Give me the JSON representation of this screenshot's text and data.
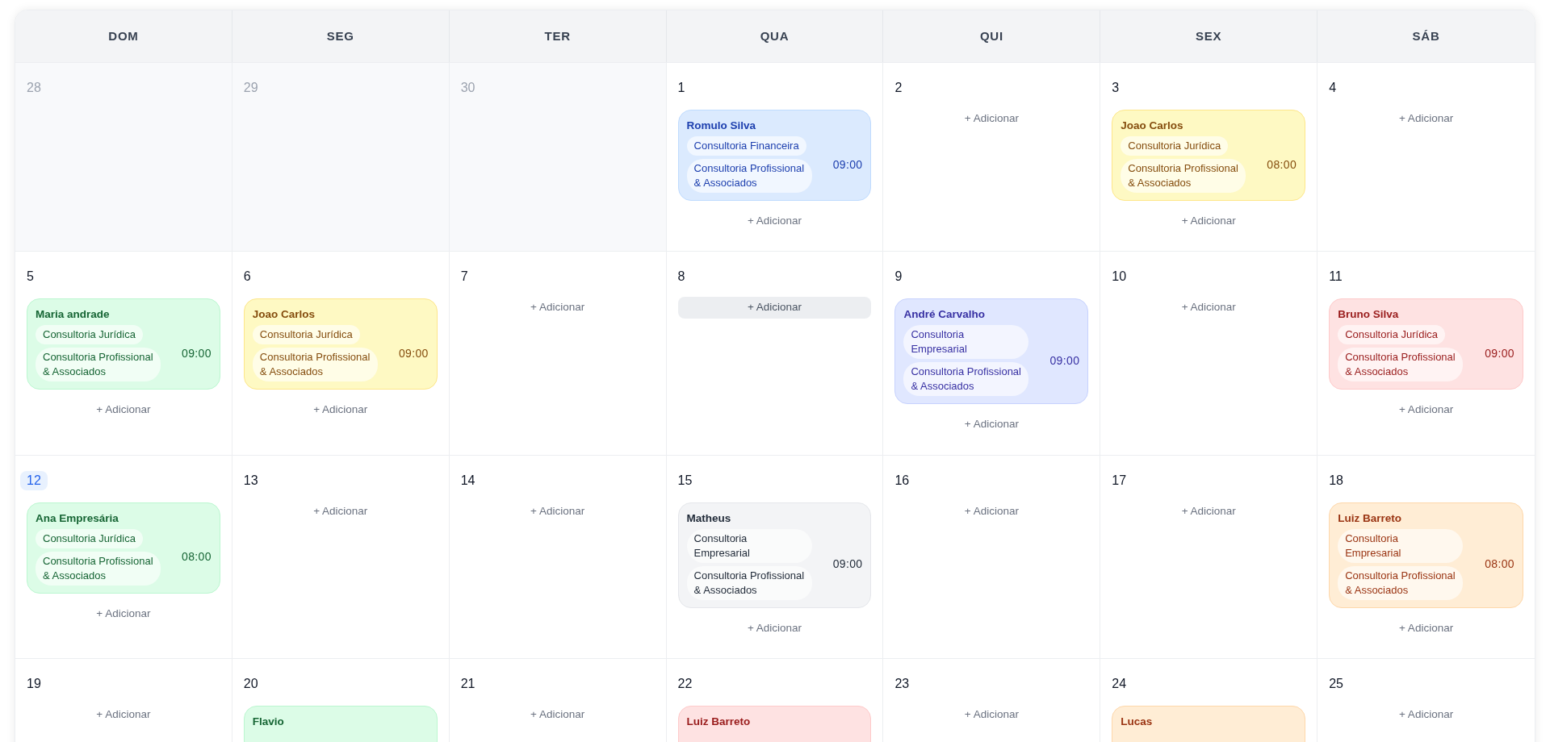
{
  "header": [
    "DOM",
    "SEG",
    "TER",
    "QUA",
    "QUI",
    "SEX",
    "SÁB"
  ],
  "weeks": [
    [
      {
        "day": "28",
        "outside_month": true,
        "today": false
      },
      {
        "day": "29",
        "outside_month": true,
        "today": false
      },
      {
        "day": "30",
        "outside_month": true,
        "today": false
      },
      {
        "day": "1",
        "outside_month": false,
        "today": false,
        "events": [
          {
            "name": "Romulo Silva",
            "color": "#dbeafe",
            "services": [
              "Consultoria Financeira",
              "Consultoria Profissional & Associados"
            ],
            "time": "09:00"
          }
        ],
        "add": {
          "label": "+ Adicionar",
          "hovered": false
        }
      },
      {
        "day": "2",
        "outside_month": false,
        "today": false,
        "add": {
          "label": "+ Adicionar",
          "hovered": false
        }
      },
      {
        "day": "3",
        "outside_month": false,
        "today": false,
        "events": [
          {
            "name": "Joao Carlos",
            "color": "#fef9c3",
            "services": [
              "Consultoria Jurídica",
              "Consultoria Profissional & Associados"
            ],
            "time": "08:00"
          }
        ],
        "add": {
          "label": "+ Adicionar",
          "hovered": false
        }
      },
      {
        "day": "4",
        "outside_month": false,
        "today": false,
        "add": {
          "label": "+ Adicionar",
          "hovered": false
        }
      }
    ],
    [
      {
        "day": "5",
        "outside_month": false,
        "today": false,
        "events": [
          {
            "name": "Maria andrade",
            "color": "#dcfce7",
            "services": [
              "Consultoria Jurídica",
              "Consultoria Profissional & Associados"
            ],
            "time": "09:00"
          }
        ],
        "add": {
          "label": "+ Adicionar",
          "hovered": false
        }
      },
      {
        "day": "6",
        "outside_month": false,
        "today": false,
        "events": [
          {
            "name": "Joao Carlos",
            "color": "#fef9c3",
            "services": [
              "Consultoria Jurídica",
              "Consultoria Profissional & Associados"
            ],
            "time": "09:00"
          }
        ],
        "add": {
          "label": "+ Adicionar",
          "hovered": false
        }
      },
      {
        "day": "7",
        "outside_month": false,
        "today": false,
        "add": {
          "label": "+ Adicionar",
          "hovered": false
        }
      },
      {
        "day": "8",
        "outside_month": false,
        "today": false,
        "add": {
          "label": "+ Adicionar",
          "hovered": true
        }
      },
      {
        "day": "9",
        "outside_month": false,
        "today": false,
        "events": [
          {
            "name": "André Carvalho",
            "color": "#e0e7ff",
            "services": [
              "Consultoria Empresarial",
              "Consultoria Profissional & Associados"
            ],
            "time": "09:00"
          }
        ],
        "add": {
          "label": "+ Adicionar",
          "hovered": false
        }
      },
      {
        "day": "10",
        "outside_month": false,
        "today": false,
        "add": {
          "label": "+ Adicionar",
          "hovered": false
        }
      },
      {
        "day": "11",
        "outside_month": false,
        "today": false,
        "events": [
          {
            "name": "Bruno Silva",
            "color": "#fee2e2",
            "services": [
              "Consultoria Jurídica",
              "Consultoria Profissional & Associados"
            ],
            "time": "09:00"
          }
        ],
        "add": {
          "label": "+ Adicionar",
          "hovered": false
        }
      }
    ],
    [
      {
        "day": "12",
        "outside_month": false,
        "today": true,
        "events": [
          {
            "name": "Ana Empresária",
            "color": "#dcfce7",
            "services": [
              "Consultoria Jurídica",
              "Consultoria Profissional & Associados"
            ],
            "time": "08:00"
          }
        ],
        "add": {
          "label": "+ Adicionar",
          "hovered": false
        }
      },
      {
        "day": "13",
        "outside_month": false,
        "today": false,
        "add": {
          "label": "+ Adicionar",
          "hovered": false
        }
      },
      {
        "day": "14",
        "outside_month": false,
        "today": false,
        "add": {
          "label": "+ Adicionar",
          "hovered": false
        }
      },
      {
        "day": "15",
        "outside_month": false,
        "today": false,
        "events": [
          {
            "name": "Matheus",
            "color": "#f3f4f6",
            "services": [
              "Consultoria Empresarial",
              "Consultoria Profissional & Associados"
            ],
            "time": "09:00"
          }
        ],
        "add": {
          "label": "+ Adicionar",
          "hovered": false
        }
      },
      {
        "day": "16",
        "outside_month": false,
        "today": false,
        "add": {
          "label": "+ Adicionar",
          "hovered": false
        }
      },
      {
        "day": "17",
        "outside_month": false,
        "today": false,
        "add": {
          "label": "+ Adicionar",
          "hovered": false
        }
      },
      {
        "day": "18",
        "outside_month": false,
        "today": false,
        "events": [
          {
            "name": "Luiz Barreto",
            "color": "#ffedd5",
            "services": [
              "Consultoria Empresarial",
              "Consultoria Profissional & Associados"
            ],
            "time": "08:00"
          }
        ],
        "add": {
          "label": "+ Adicionar",
          "hovered": false
        }
      }
    ],
    [
      {
        "day": "19",
        "outside_month": false,
        "today": false,
        "add": {
          "label": "+ Adicionar",
          "hovered": false
        }
      },
      {
        "day": "20",
        "outside_month": false,
        "today": false,
        "events": [
          {
            "name": "Flavio",
            "color": "#dcfce7"
          }
        ]
      },
      {
        "day": "21",
        "outside_month": false,
        "today": false,
        "add": {
          "label": "+ Adicionar",
          "hovered": false
        }
      },
      {
        "day": "22",
        "outside_month": false,
        "today": false,
        "events": [
          {
            "name": "Luiz Barreto",
            "color": "#fee2e2"
          }
        ]
      },
      {
        "day": "23",
        "outside_month": false,
        "today": false,
        "add": {
          "label": "+ Adicionar",
          "hovered": false
        }
      },
      {
        "day": "24",
        "outside_month": false,
        "today": false,
        "events": [
          {
            "name": "Lucas",
            "color": "#ffedd5"
          }
        ]
      },
      {
        "day": "25",
        "outside_month": false,
        "today": false,
        "add": {
          "label": "+ Adicionar",
          "hovered": false
        }
      }
    ]
  ]
}
